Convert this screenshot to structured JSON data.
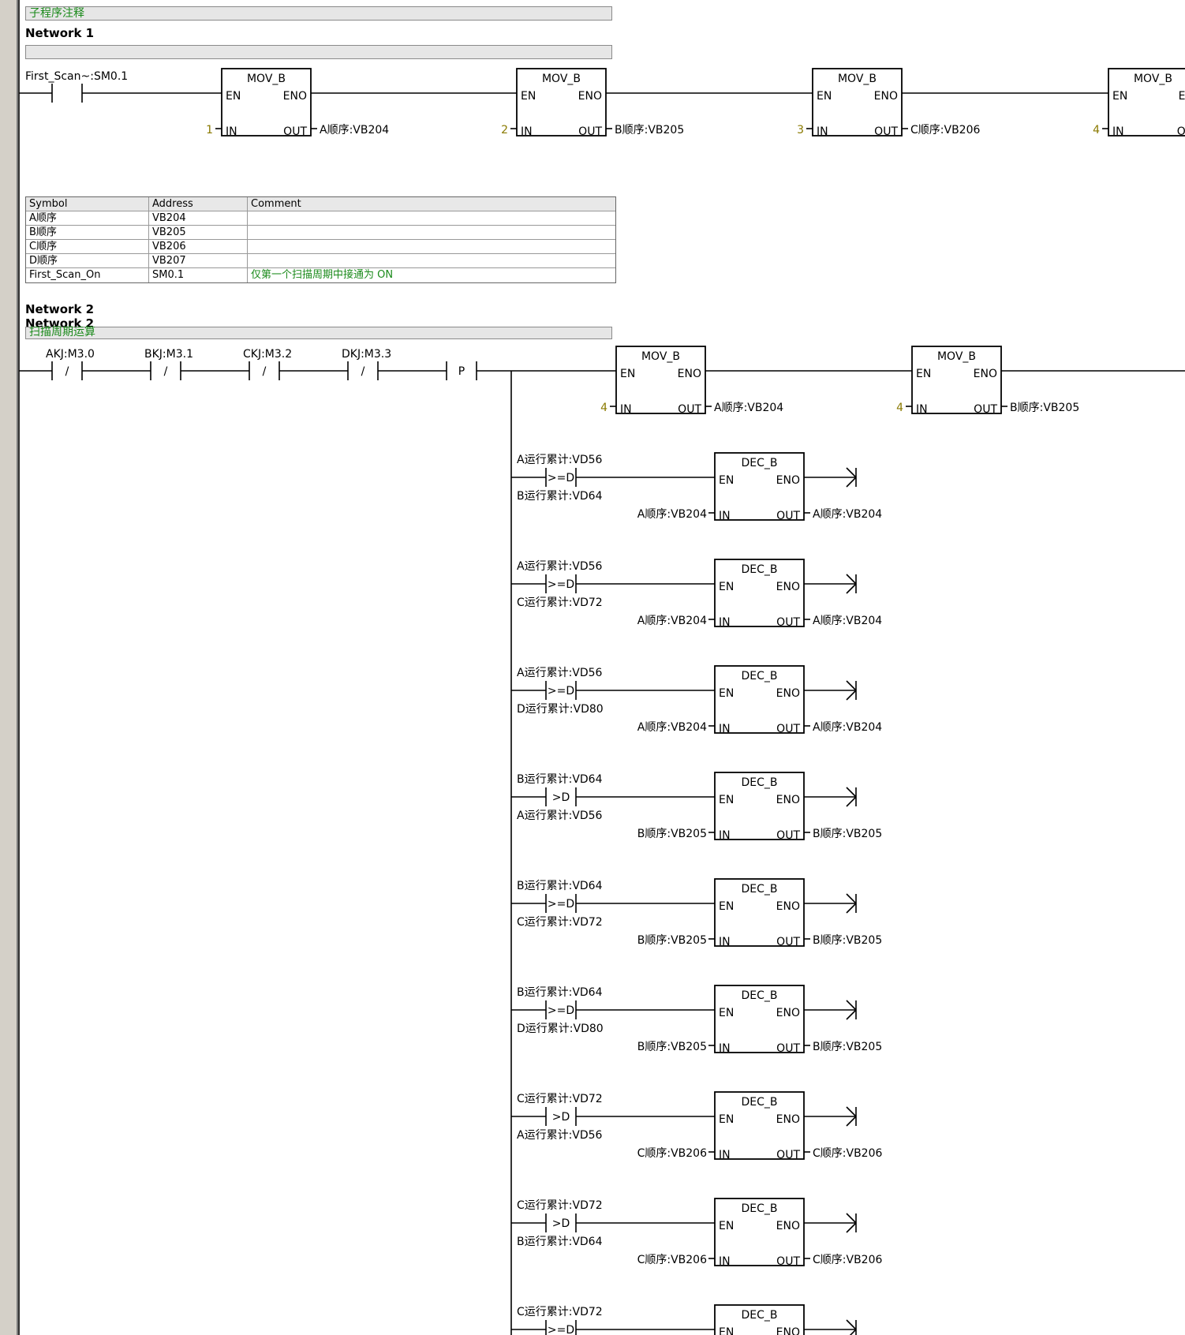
{
  "subroutine_comment": "子程序注释",
  "network1": {
    "title": "Network 1",
    "contact": "First_Scan~:SM0.1",
    "mov_blocks": [
      {
        "name": "MOV_B",
        "en": "EN",
        "eno": "ENO",
        "in": "IN",
        "out": "OUT",
        "in_val": "1",
        "out_val": "A顺序:VB204"
      },
      {
        "name": "MOV_B",
        "en": "EN",
        "eno": "ENO",
        "in": "IN",
        "out": "OUT",
        "in_val": "2",
        "out_val": "B顺序:VB205"
      },
      {
        "name": "MOV_B",
        "en": "EN",
        "eno": "ENO",
        "in": "IN",
        "out": "OUT",
        "in_val": "3",
        "out_val": "C顺序:VB206"
      },
      {
        "name": "MOV_B",
        "en": "EN",
        "eno": "EN",
        "in": "IN",
        "out": "OU",
        "in_val": "4",
        "out_val": ""
      }
    ]
  },
  "symbol_table": {
    "headers": [
      "Symbol",
      "Address",
      "Comment"
    ],
    "rows": [
      [
        "A顺序",
        "VB204",
        ""
      ],
      [
        "B顺序",
        "VB205",
        ""
      ],
      [
        "C顺序",
        "VB206",
        ""
      ],
      [
        "D顺序",
        "VB207",
        ""
      ],
      [
        "First_Scan_On",
        "SM0.1",
        "仅第一个扫描周期中接通为 ON"
      ]
    ]
  },
  "network2": {
    "title": "Network 2",
    "title_overlap": "Network 2",
    "comment": "扫描周期运算",
    "contacts": [
      "AKJ:M3.0",
      "BKJ:M3.1",
      "CKJ:M3.2",
      "DKJ:M3.3"
    ],
    "nc_symbol": "/",
    "p_symbol": "P",
    "mov_blocks": [
      {
        "name": "MOV_B",
        "en": "EN",
        "eno": "ENO",
        "in": "IN",
        "out": "OUT",
        "in_val": "4",
        "out_val": "A顺序:VB204"
      },
      {
        "name": "MOV_B",
        "en": "EN",
        "eno": "ENO",
        "in": "IN",
        "out": "OUT",
        "in_val": "4",
        "out_val": "B顺序:VB205"
      }
    ],
    "dec_rows": [
      {
        "top": "A运行累计:VD56",
        "op": ">=D",
        "bottom": "B运行累计:VD64",
        "in_val": "A顺序:VB204",
        "out_val": "A顺序:VB204"
      },
      {
        "top": "A运行累计:VD56",
        "op": ">=D",
        "bottom": "C运行累计:VD72",
        "in_val": "A顺序:VB204",
        "out_val": "A顺序:VB204"
      },
      {
        "top": "A运行累计:VD56",
        "op": ">=D",
        "bottom": "D运行累计:VD80",
        "in_val": "A顺序:VB204",
        "out_val": "A顺序:VB204"
      },
      {
        "top": "B运行累计:VD64",
        "op": ">D",
        "bottom": "A运行累计:VD56",
        "in_val": "B顺序:VB205",
        "out_val": "B顺序:VB205"
      },
      {
        "top": "B运行累计:VD64",
        "op": ">=D",
        "bottom": "C运行累计:VD72",
        "in_val": "B顺序:VB205",
        "out_val": "B顺序:VB205"
      },
      {
        "top": "B运行累计:VD64",
        "op": ">=D",
        "bottom": "D运行累计:VD80",
        "in_val": "B顺序:VB205",
        "out_val": "B顺序:VB205"
      },
      {
        "top": "C运行累计:VD72",
        "op": ">D",
        "bottom": "A运行累计:VD56",
        "in_val": "C顺序:VB206",
        "out_val": "C顺序:VB206"
      },
      {
        "top": "C运行累计:VD72",
        "op": ">D",
        "bottom": "B运行累计:VD64",
        "in_val": "C顺序:VB206",
        "out_val": "C顺序:VB206"
      },
      {
        "top": "C运行累计:VD72",
        "op": ">=D",
        "bottom": "",
        "in_val": "",
        "out_val": ""
      }
    ],
    "dec_block": {
      "name": "DEC_B",
      "en": "EN",
      "eno": "ENO",
      "in": "IN",
      "out": "OUT"
    }
  }
}
